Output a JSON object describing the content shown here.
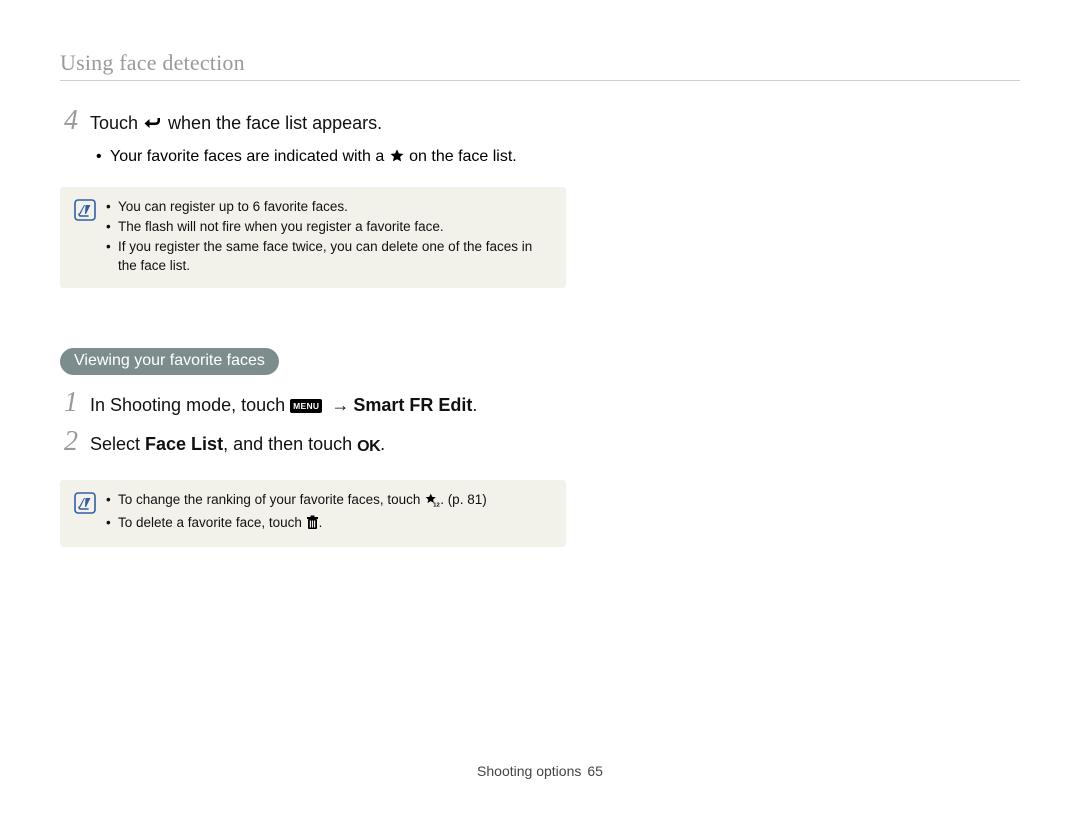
{
  "chapter_title": "Using face detection",
  "step4": {
    "num": "4",
    "prefix": "Touch ",
    "suffix": " when the face list appears.",
    "bullet_prefix": "Your favorite faces are indicated with a ",
    "bullet_suffix": " on the face list."
  },
  "notebox1": {
    "items": [
      "You can register up to 6 favorite faces.",
      "The flash will not fire when you register a favorite face.",
      "If you register the same face twice, you can delete one of the faces in the face list."
    ]
  },
  "pill_label": "Viewing your favorite faces",
  "step1": {
    "num": "1",
    "prefix": "In Shooting mode, touch ",
    "menu_chip": "MENU",
    "arrow": "→",
    "bold": "Smart FR Edit",
    "period": "."
  },
  "step2": {
    "num": "2",
    "a": "Select ",
    "bold": "Face List",
    "b": ", and then touch ",
    "ok": "OK",
    "period": "."
  },
  "notebox2": {
    "line1_a": "To change the ranking of your favorite faces, touch ",
    "line1_b": ". (p. 81)",
    "line2_a": "To delete a favorite face, touch ",
    "line2_b": "."
  },
  "footer": {
    "label": "Shooting options",
    "page": "65"
  }
}
